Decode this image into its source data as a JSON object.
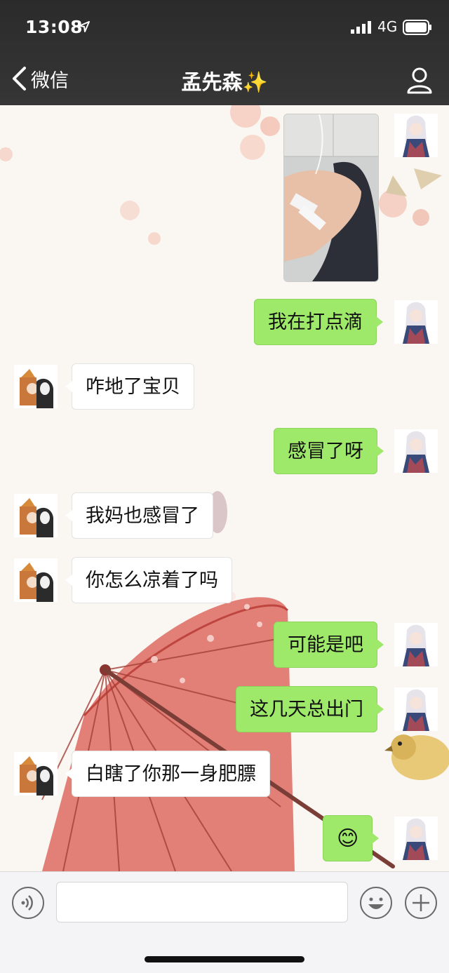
{
  "status_bar": {
    "time": "13:08",
    "network": "4G",
    "location_icon": "location-arrow-icon",
    "signal_icon": "signal-bars-icon",
    "battery_icon": "battery-icon"
  },
  "nav": {
    "back_label": "微信",
    "title": "孟先森✨",
    "back_icon": "chevron-left-icon",
    "profile_icon": "person-icon"
  },
  "messages": [
    {
      "side": "me",
      "type": "image",
      "text": ""
    },
    {
      "side": "me",
      "type": "text",
      "text": "我在打点滴"
    },
    {
      "side": "them",
      "type": "text",
      "text": "咋地了宝贝"
    },
    {
      "side": "me",
      "type": "text",
      "text": "感冒了呀"
    },
    {
      "side": "them",
      "type": "text",
      "text": "我妈也感冒了"
    },
    {
      "side": "them",
      "type": "text",
      "text": "你怎么凉着了吗"
    },
    {
      "side": "me",
      "type": "text",
      "text": "可能是吧"
    },
    {
      "side": "me",
      "type": "text",
      "text": "这几天总出门"
    },
    {
      "side": "them",
      "type": "text",
      "text": "白瞎了你那一身肥膘"
    },
    {
      "side": "me",
      "type": "text",
      "text": "😊"
    }
  ],
  "input_bar": {
    "value": "",
    "voice_icon": "voice-icon",
    "emoji_icon": "emoji-face-icon",
    "plus_icon": "plus-circle-icon"
  },
  "colors": {
    "nav_bg": "#2e2e2e",
    "bubble_me": "#9ee86a",
    "bubble_them": "#ffffff",
    "umbrella": "#d9534a"
  }
}
